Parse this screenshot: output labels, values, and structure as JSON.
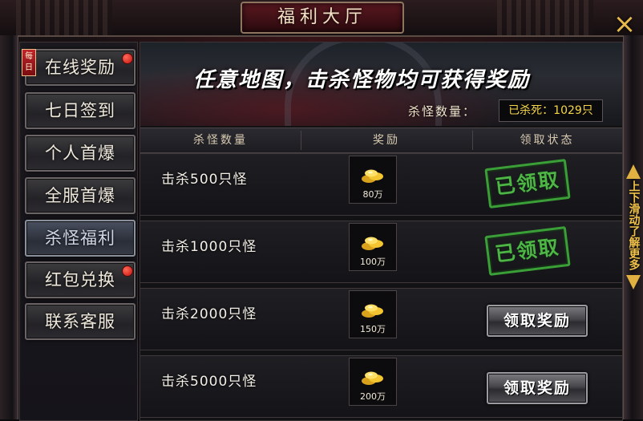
{
  "window": {
    "title": "福利大厅",
    "close_icon": "×"
  },
  "menu": {
    "daily_tag": "每日",
    "items": [
      {
        "label": "在线奖励",
        "badge": true
      },
      {
        "label": "七日签到",
        "badge": false
      },
      {
        "label": "个人首爆",
        "badge": false
      },
      {
        "label": "全服首爆",
        "badge": false
      },
      {
        "label": "杀怪福利",
        "badge": false,
        "active": true
      },
      {
        "label": "红包兑换",
        "badge": true
      },
      {
        "label": "联系客服",
        "badge": false
      }
    ]
  },
  "banner": {
    "title": "任意地图，击杀怪物均可获得奖励",
    "kill_label": "杀怪数量：",
    "kill_value": "已杀死：1029只"
  },
  "table": {
    "headers": [
      "杀怪数量",
      "奖励",
      "领取状态"
    ],
    "rows": [
      {
        "label": "击杀500只怪",
        "reward": "80万",
        "status": "已领取",
        "claimed": true
      },
      {
        "label": "击杀1000只怪",
        "reward": "100万",
        "status": "已领取",
        "claimed": true
      },
      {
        "label": "击杀2000只怪",
        "reward": "150万",
        "status": "领取奖励",
        "claimed": false
      },
      {
        "label": "击杀5000只怪",
        "reward": "200万",
        "status": "领取奖励",
        "claimed": false
      }
    ]
  },
  "scroll_hint": "上下滑动了解更多",
  "colors": {
    "stamp": "#53c74a",
    "kill_value": "#f5d64a",
    "accent": "#e0b040",
    "badge": "#c4100a"
  }
}
